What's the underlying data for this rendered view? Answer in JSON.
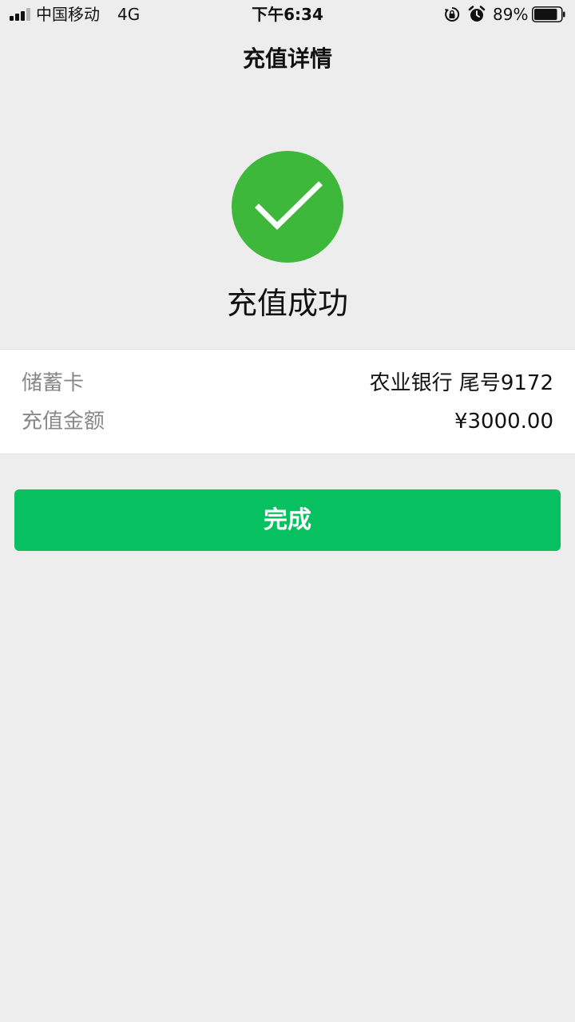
{
  "status_bar": {
    "carrier": "中国移动",
    "network": "4G",
    "time": "下午6:34",
    "battery_percent": "89%",
    "battery_level": 0.89,
    "icons": [
      "signal-icon",
      "rotation-lock-icon",
      "alarm-icon",
      "battery-icon"
    ]
  },
  "nav": {
    "title": "充值详情"
  },
  "result": {
    "icon": "check-circle-icon",
    "icon_color": "#3eb83a",
    "message": "充值成功"
  },
  "details": {
    "card_label": "储蓄卡",
    "card_value": "农业银行 尾号9172",
    "amount_label": "充值金额",
    "amount_value": "¥3000.00"
  },
  "actions": {
    "done_label": "完成",
    "done_color": "#07c160"
  }
}
